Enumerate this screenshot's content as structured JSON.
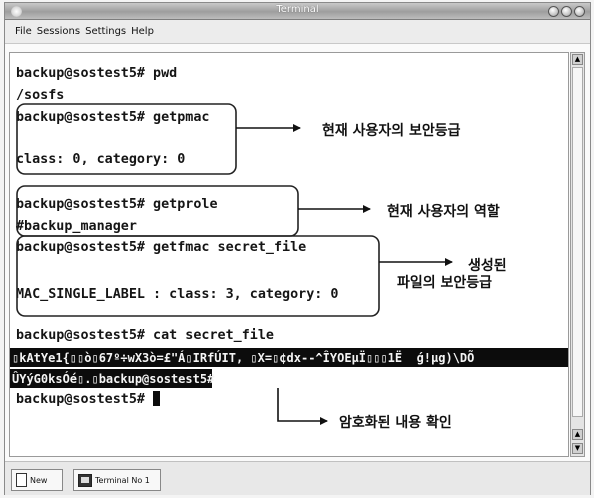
{
  "window": {
    "title": "Terminal"
  },
  "menu": [
    "File",
    "Sessions",
    "Settings",
    "Help"
  ],
  "terminal": {
    "lines": [
      "backup@sostest5# pwd",
      "/sosfs",
      "backup@sostest5# getpmac",
      "class: 0, category: 0",
      "backup@sostest5# getprole",
      "#backup_manager",
      "backup@sostest5# getfmac secret_file",
      "MAC_SINGLE_LABEL : class: 3, category: 0",
      "backup@sostest5# cat secret_file",
      "▯kAtYe1{▯▯ò▯67º÷wX3ò=£\"Á▯IRfÚIT, ▯X=▯¢dx--^ÎYOEµÏ▯▯▯1Ë  ǵ!µg)\\DÕ",
      "ÛYýG0ksÓé▯.▯backup@sostest5#",
      "backup@sostest5# "
    ]
  },
  "annotations": {
    "a1": "현재 사용자의 보안등급",
    "a2": "현재 사용자의 역할",
    "a3_line1": "생성된",
    "a3_line2": "파일의 보안등급",
    "a4": "암호화된 내용 확인"
  },
  "taskbar": {
    "new_label": "New",
    "terminal_label": "Terminal No 1"
  }
}
